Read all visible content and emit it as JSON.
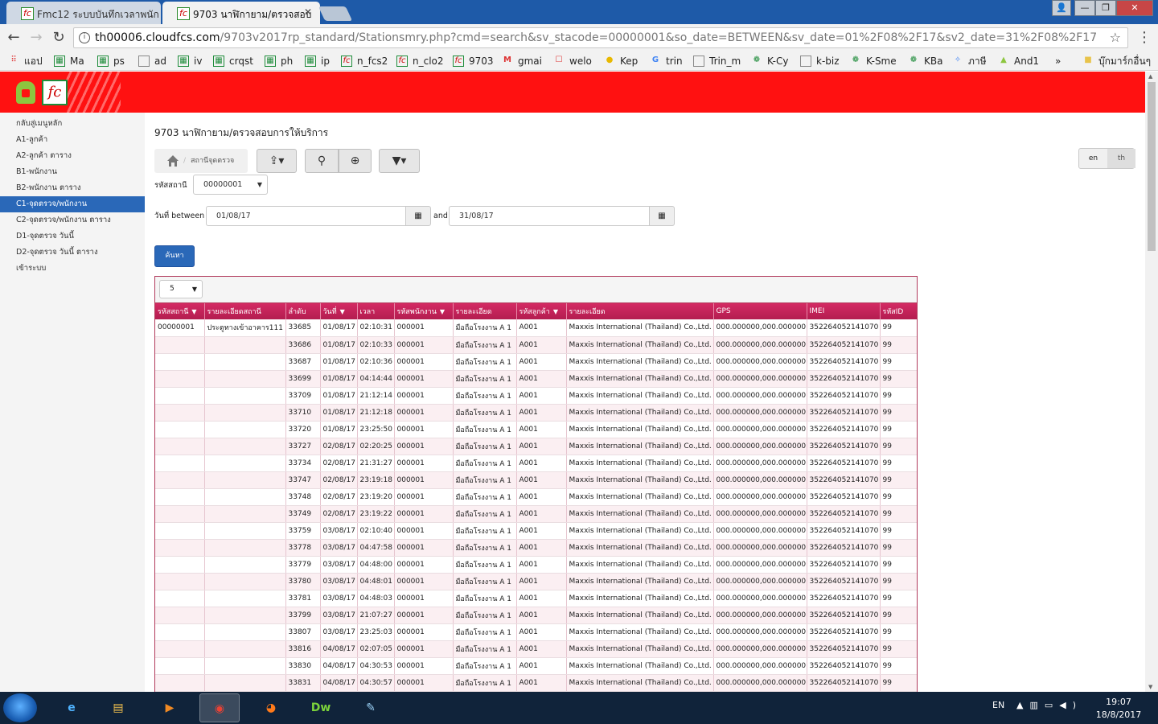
{
  "browser": {
    "tabs": [
      {
        "title": "Fmc12 ระบบบันทึกเวลาพนัก",
        "active": false
      },
      {
        "title": "9703 นาฬิกายาม/ตรวจสอบ",
        "active": true
      }
    ],
    "window_controls": {
      "minimize": "—",
      "maximize": "❐",
      "close": "✕"
    },
    "url_host": "th00006.cloudfcs.com",
    "url_path": "/9703v2017rp_standard/Stationsmry.php?cmd=search&sv_stacode=00000001&so_date=BETWEEN&sv_date=01%2F08%2F17&sv2_date=31%2F08%2F17",
    "bookmarks": [
      {
        "label": "แอป",
        "icon": "apps-grid-icon"
      },
      {
        "label": "Ma",
        "icon": "sheet-icon"
      },
      {
        "label": "ps",
        "icon": "sheet-icon"
      },
      {
        "label": "ad",
        "icon": "doc-icon"
      },
      {
        "label": "iv",
        "icon": "sheet-icon"
      },
      {
        "label": "crqst",
        "icon": "sheet-icon"
      },
      {
        "label": "ph",
        "icon": "sheet-icon"
      },
      {
        "label": "ip",
        "icon": "sheet-icon"
      },
      {
        "label": "n_fcs2",
        "icon": "fc-icon"
      },
      {
        "label": "n_clo2",
        "icon": "fc-icon"
      },
      {
        "label": "9703",
        "icon": "fc-icon"
      },
      {
        "label": "gmai",
        "icon": "gmail-icon"
      },
      {
        "label": "welo",
        "icon": "bag-icon"
      },
      {
        "label": "Kep",
        "icon": "bulb-icon"
      },
      {
        "label": "trin",
        "icon": "google-icon"
      },
      {
        "label": "Trin_m",
        "icon": "doc-icon"
      },
      {
        "label": "K-Cy",
        "icon": "kbank-icon"
      },
      {
        "label": "k-biz",
        "icon": "doc-icon"
      },
      {
        "label": "K-Sme",
        "icon": "kbank-icon"
      },
      {
        "label": "KBa",
        "icon": "kbank-icon"
      },
      {
        "label": "ภาษี",
        "icon": "tax-icon"
      },
      {
        "label": "And1",
        "icon": "android-icon"
      },
      {
        "label": "»",
        "icon": ""
      },
      {
        "label": "บุ๊กมาร์กอื่นๆ",
        "icon": "folder-icon"
      }
    ]
  },
  "sidebar": {
    "items": [
      {
        "label": "กลับสู่เมนูหลัก",
        "active": false
      },
      {
        "label": "A1-ลูกค้า",
        "active": false
      },
      {
        "label": "A2-ลูกค้า ตาราง",
        "active": false
      },
      {
        "label": "B1-พนักงาน",
        "active": false
      },
      {
        "label": "B2-พนักงาน ตาราง",
        "active": false
      },
      {
        "label": "C1-จุดตรวจ/พนักงาน",
        "active": true
      },
      {
        "label": "C2-จุดตรวจ/พนักงาน ตาราง",
        "active": false
      },
      {
        "label": "D1-จุดตรวจ วันนี้",
        "active": false
      },
      {
        "label": "D2-จุดตรวจ วันนี้ ตาราง",
        "active": false
      },
      {
        "label": "เข้าระบบ",
        "active": false
      }
    ]
  },
  "main": {
    "title": "9703 นาฬิกายาม/ตรวจสอบการให้บริการ",
    "breadcrumb": "สถานีจุดตรวจ",
    "lang": {
      "en": "en",
      "th": "th"
    },
    "station_label": "รหัสสถานี",
    "station_value": "00000001",
    "date_label": "วันที่ between",
    "date_from": "01/08/17",
    "and_label": "and",
    "date_to": "31/08/17",
    "search_label": "ค้นหา",
    "page_size": "5"
  },
  "table": {
    "columns": [
      "รหัสสถานี",
      "รายละเอียดสถานี",
      "ลำดับ",
      "วันที่",
      "เวลา",
      "รหัสพนักงาน",
      "รายละเอียด",
      "รหัสลูกค้า",
      "รายละเอียด",
      "GPS",
      "IMEI",
      "รหัสID"
    ],
    "filterable": [
      true,
      false,
      false,
      true,
      false,
      true,
      false,
      true,
      false,
      false,
      false,
      false
    ],
    "rows": [
      [
        "00000001",
        "ประตูทางเข้าอาคาร111",
        "33685",
        "01/08/17",
        "02:10:31",
        "000001",
        "มือถือโรงงาน A 1",
        "A001",
        "Maxxis International (Thailand) Co.,Ltd.",
        "000.000000,000.000000",
        "352264052141070",
        "99"
      ],
      [
        "",
        "",
        "33686",
        "01/08/17",
        "02:10:33",
        "000001",
        "มือถือโรงงาน A 1",
        "A001",
        "Maxxis International (Thailand) Co.,Ltd.",
        "000.000000,000.000000",
        "352264052141070",
        "99"
      ],
      [
        "",
        "",
        "33687",
        "01/08/17",
        "02:10:36",
        "000001",
        "มือถือโรงงาน A 1",
        "A001",
        "Maxxis International (Thailand) Co.,Ltd.",
        "000.000000,000.000000",
        "352264052141070",
        "99"
      ],
      [
        "",
        "",
        "33699",
        "01/08/17",
        "04:14:44",
        "000001",
        "มือถือโรงงาน A 1",
        "A001",
        "Maxxis International (Thailand) Co.,Ltd.",
        "000.000000,000.000000",
        "352264052141070",
        "99"
      ],
      [
        "",
        "",
        "33709",
        "01/08/17",
        "21:12:14",
        "000001",
        "มือถือโรงงาน A 1",
        "A001",
        "Maxxis International (Thailand) Co.,Ltd.",
        "000.000000,000.000000",
        "352264052141070",
        "99"
      ],
      [
        "",
        "",
        "33710",
        "01/08/17",
        "21:12:18",
        "000001",
        "มือถือโรงงาน A 1",
        "A001",
        "Maxxis International (Thailand) Co.,Ltd.",
        "000.000000,000.000000",
        "352264052141070",
        "99"
      ],
      [
        "",
        "",
        "33720",
        "01/08/17",
        "23:25:50",
        "000001",
        "มือถือโรงงาน A 1",
        "A001",
        "Maxxis International (Thailand) Co.,Ltd.",
        "000.000000,000.000000",
        "352264052141070",
        "99"
      ],
      [
        "",
        "",
        "33727",
        "02/08/17",
        "02:20:25",
        "000001",
        "มือถือโรงงาน A 1",
        "A001",
        "Maxxis International (Thailand) Co.,Ltd.",
        "000.000000,000.000000",
        "352264052141070",
        "99"
      ],
      [
        "",
        "",
        "33734",
        "02/08/17",
        "21:31:27",
        "000001",
        "มือถือโรงงาน A 1",
        "A001",
        "Maxxis International (Thailand) Co.,Ltd.",
        "000.000000,000.000000",
        "352264052141070",
        "99"
      ],
      [
        "",
        "",
        "33747",
        "02/08/17",
        "23:19:18",
        "000001",
        "มือถือโรงงาน A 1",
        "A001",
        "Maxxis International (Thailand) Co.,Ltd.",
        "000.000000,000.000000",
        "352264052141070",
        "99"
      ],
      [
        "",
        "",
        "33748",
        "02/08/17",
        "23:19:20",
        "000001",
        "มือถือโรงงาน A 1",
        "A001",
        "Maxxis International (Thailand) Co.,Ltd.",
        "000.000000,000.000000",
        "352264052141070",
        "99"
      ],
      [
        "",
        "",
        "33749",
        "02/08/17",
        "23:19:22",
        "000001",
        "มือถือโรงงาน A 1",
        "A001",
        "Maxxis International (Thailand) Co.,Ltd.",
        "000.000000,000.000000",
        "352264052141070",
        "99"
      ],
      [
        "",
        "",
        "33759",
        "03/08/17",
        "02:10:40",
        "000001",
        "มือถือโรงงาน A 1",
        "A001",
        "Maxxis International (Thailand) Co.,Ltd.",
        "000.000000,000.000000",
        "352264052141070",
        "99"
      ],
      [
        "",
        "",
        "33778",
        "03/08/17",
        "04:47:58",
        "000001",
        "มือถือโรงงาน A 1",
        "A001",
        "Maxxis International (Thailand) Co.,Ltd.",
        "000.000000,000.000000",
        "352264052141070",
        "99"
      ],
      [
        "",
        "",
        "33779",
        "03/08/17",
        "04:48:00",
        "000001",
        "มือถือโรงงาน A 1",
        "A001",
        "Maxxis International (Thailand) Co.,Ltd.",
        "000.000000,000.000000",
        "352264052141070",
        "99"
      ],
      [
        "",
        "",
        "33780",
        "03/08/17",
        "04:48:01",
        "000001",
        "มือถือโรงงาน A 1",
        "A001",
        "Maxxis International (Thailand) Co.,Ltd.",
        "000.000000,000.000000",
        "352264052141070",
        "99"
      ],
      [
        "",
        "",
        "33781",
        "03/08/17",
        "04:48:03",
        "000001",
        "มือถือโรงงาน A 1",
        "A001",
        "Maxxis International (Thailand) Co.,Ltd.",
        "000.000000,000.000000",
        "352264052141070",
        "99"
      ],
      [
        "",
        "",
        "33799",
        "03/08/17",
        "21:07:27",
        "000001",
        "มือถือโรงงาน A 1",
        "A001",
        "Maxxis International (Thailand) Co.,Ltd.",
        "000.000000,000.000000",
        "352264052141070",
        "99"
      ],
      [
        "",
        "",
        "33807",
        "03/08/17",
        "23:25:03",
        "000001",
        "มือถือโรงงาน A 1",
        "A001",
        "Maxxis International (Thailand) Co.,Ltd.",
        "000.000000,000.000000",
        "352264052141070",
        "99"
      ],
      [
        "",
        "",
        "33816",
        "04/08/17",
        "02:07:05",
        "000001",
        "มือถือโรงงาน A 1",
        "A001",
        "Maxxis International (Thailand) Co.,Ltd.",
        "000.000000,000.000000",
        "352264052141070",
        "99"
      ],
      [
        "",
        "",
        "33830",
        "04/08/17",
        "04:30:53",
        "000001",
        "มือถือโรงงาน A 1",
        "A001",
        "Maxxis International (Thailand) Co.,Ltd.",
        "000.000000,000.000000",
        "352264052141070",
        "99"
      ],
      [
        "",
        "",
        "33831",
        "04/08/17",
        "04:30:57",
        "000001",
        "มือถือโรงงาน A 1",
        "A001",
        "Maxxis International (Thailand) Co.,Ltd.",
        "000.000000,000.000000",
        "352264052141070",
        "99"
      ]
    ]
  },
  "taskbar": {
    "apps": [
      {
        "name": "internet-explorer",
        "glyph": "e",
        "color": "#4fb3ff",
        "active": false
      },
      {
        "name": "file-explorer",
        "glyph": "▤",
        "color": "#f2c14e",
        "active": false
      },
      {
        "name": "media-player",
        "glyph": "▶",
        "color": "#f08a24",
        "active": false
      },
      {
        "name": "chrome",
        "glyph": "◉",
        "color": "#e94235",
        "active": true
      },
      {
        "name": "firefox",
        "glyph": "◕",
        "color": "#ff7a1a",
        "active": false
      },
      {
        "name": "dreamweaver",
        "glyph": "Dw",
        "color": "#7bd13b",
        "active": false
      },
      {
        "name": "paint",
        "glyph": "✎",
        "color": "#9ad0f5",
        "active": false
      }
    ],
    "lang": "EN",
    "time": "19:07",
    "date": "18/8/2017"
  },
  "colors": {
    "header": "#ff1111",
    "accent": "#2a68b8",
    "table_header": "#c2245a"
  }
}
